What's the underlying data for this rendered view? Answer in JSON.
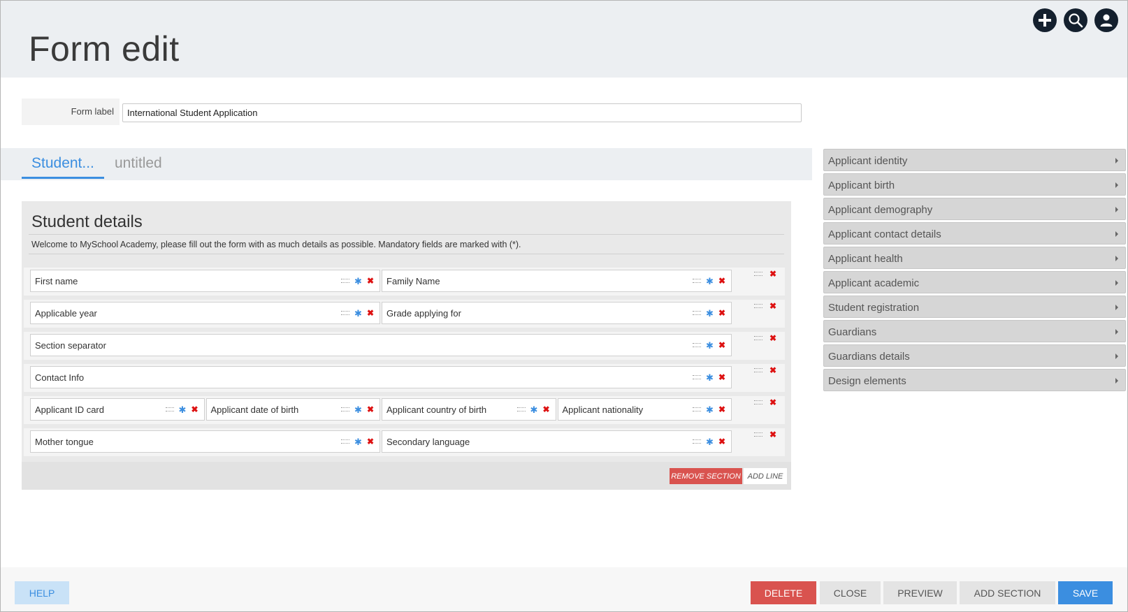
{
  "page": {
    "title": "Form edit"
  },
  "header_actions": {
    "add": "plus-icon",
    "search": "search-icon",
    "user": "user-icon"
  },
  "form_label": {
    "label": "Form label",
    "value": "International Student Application"
  },
  "tabs": [
    {
      "label": "Student...",
      "active": true
    },
    {
      "label": "untitled",
      "active": false
    }
  ],
  "section": {
    "title": "Student details",
    "description": "Welcome to MySchool Academy, please fill out the form with as much details as possible. Mandatory fields are marked with (*).",
    "lines": [
      {
        "fields": [
          "First name",
          "Family Name"
        ]
      },
      {
        "fields": [
          "Applicable year",
          "Grade applying for"
        ]
      },
      {
        "fields": [
          "Section separator"
        ]
      },
      {
        "fields": [
          "Contact Info"
        ]
      },
      {
        "fields": [
          "Applicant ID card",
          "Applicant date of birth",
          "Applicant country of birth",
          "Applicant nationality"
        ]
      },
      {
        "fields": [
          "Mother tongue",
          "Secondary language"
        ]
      }
    ],
    "remove_section": "REMOVE SECTION",
    "add_line": "ADD LINE"
  },
  "palette": [
    "Applicant identity",
    "Applicant birth",
    "Applicant demography",
    "Applicant contact details",
    "Applicant health",
    "Applicant academic",
    "Student registration",
    "Guardians",
    "Guardians details",
    "Design elements"
  ],
  "footer": {
    "help": "HELP",
    "delete": "DELETE",
    "close": "CLOSE",
    "preview": "PREVIEW",
    "add_section": "ADD SECTION",
    "save": "SAVE"
  },
  "colors": {
    "accent": "#3b8ee0",
    "danger": "#d9534f",
    "header_bg": "#eceff2",
    "icon_dark": "#14202e"
  }
}
